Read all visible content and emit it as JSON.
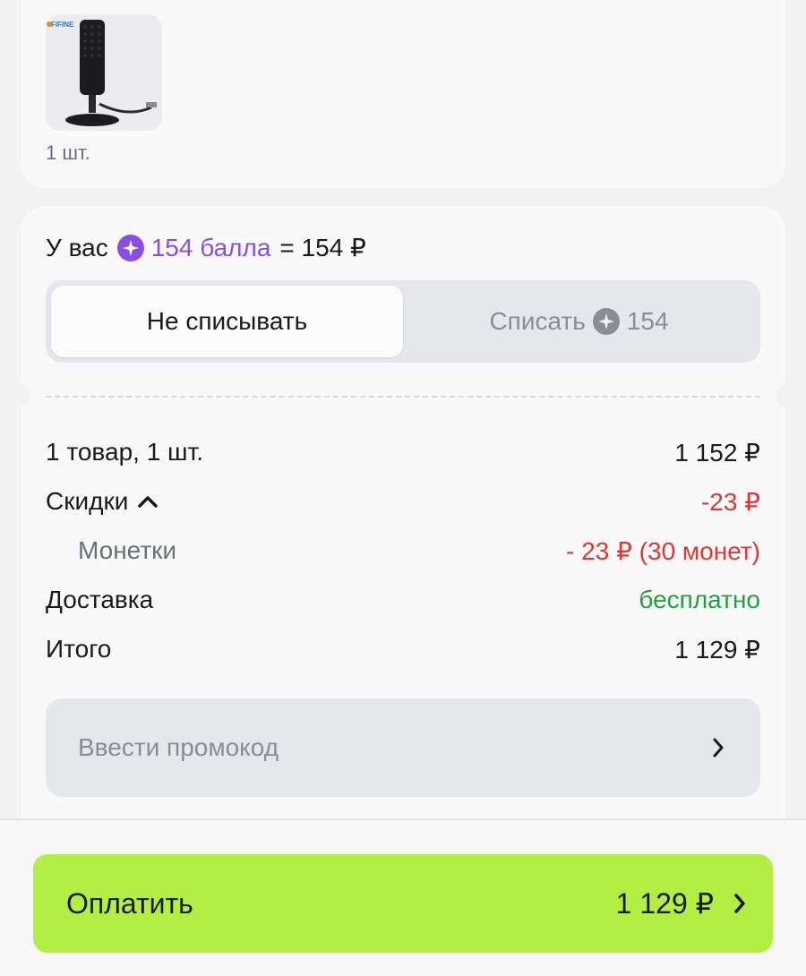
{
  "product": {
    "image_icon": "microphone-product-image",
    "brand_mark": "FIFINE",
    "quantity": "1 шт."
  },
  "points": {
    "prefix": "У вас",
    "amount": "154 балла",
    "equals": "= 154 ₽",
    "icon": "star-points-icon"
  },
  "toggle": {
    "dont_use": "Не списывать",
    "use": "Списать",
    "use_amount": "154"
  },
  "summary": {
    "items_label": "1 товар, 1 шт.",
    "items_value": "1 152 ₽",
    "discounts_label": "Скидки",
    "discounts_value": "-23 ₽",
    "coins_label": "Монетки",
    "coins_value": "- 23 ₽ (30 монет)",
    "delivery_label": "Доставка",
    "delivery_value": "бесплатно",
    "total_label": "Итого",
    "total_value": "1 129 ₽"
  },
  "promo": {
    "label": "Ввести промокод"
  },
  "pay": {
    "label": "Оплатить",
    "amount": "1 129 ₽"
  },
  "colors": {
    "accent_purple": "#8a4fe0",
    "discount_red": "#e0372e",
    "free_green": "#1fa33f",
    "pay_button": "#b3ee45"
  }
}
